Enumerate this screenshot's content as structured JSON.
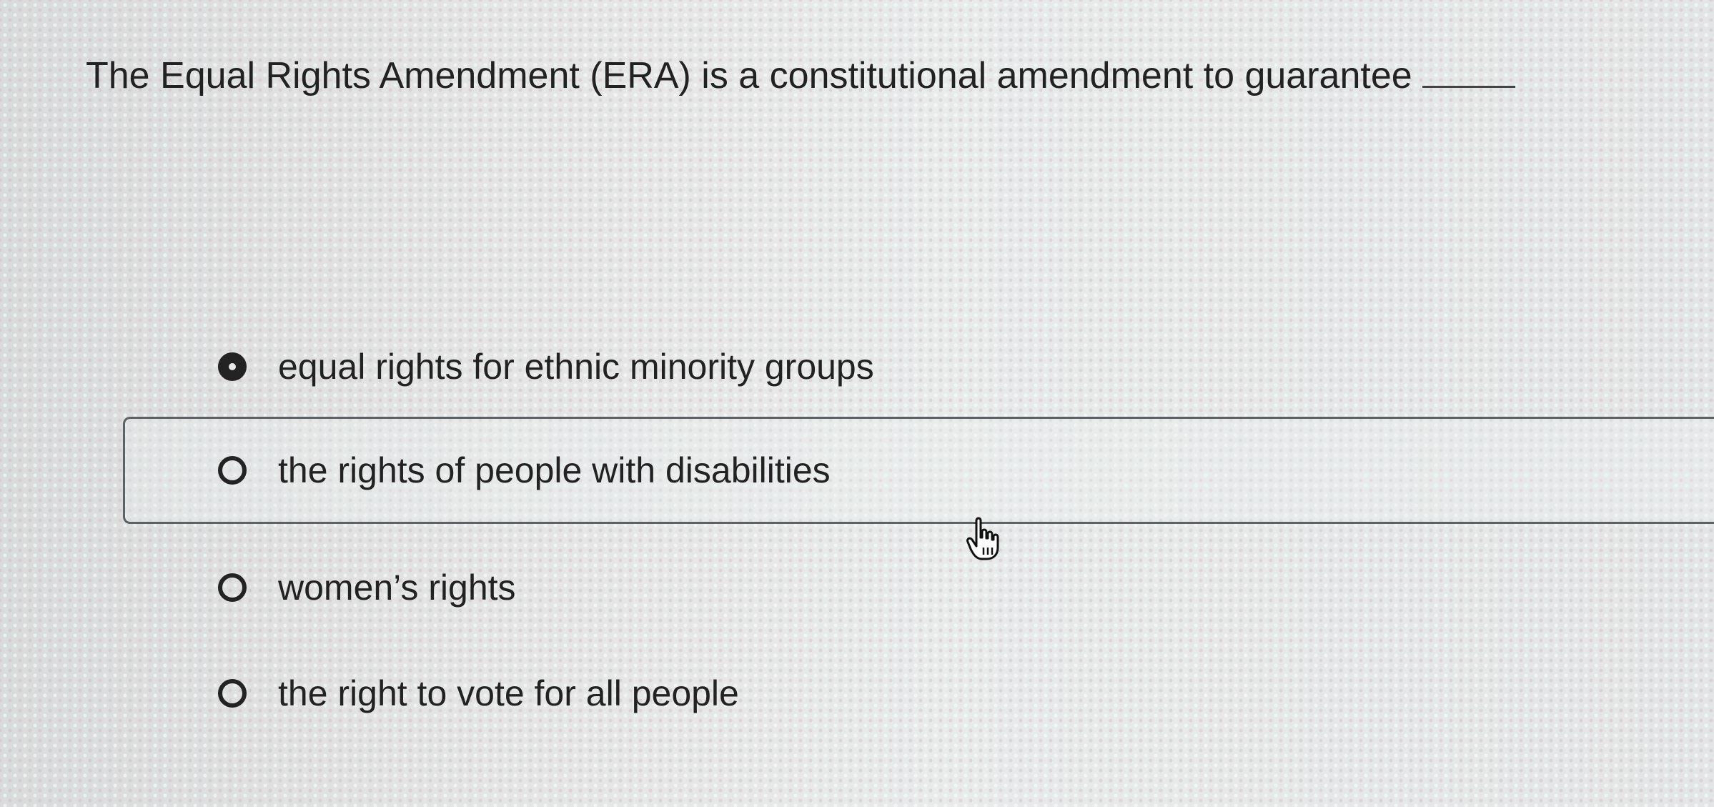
{
  "question": {
    "text": "The Equal Rights Amendment (ERA) is a constitutional amendment to guarantee"
  },
  "options": [
    {
      "label": "equal rights for ethnic minority groups",
      "selected": true
    },
    {
      "label": "the rights of people with disabilities",
      "selected": false,
      "hovered": true
    },
    {
      "label": "women’s rights",
      "selected": false
    },
    {
      "label": "the right to vote for all people",
      "selected": false
    }
  ],
  "cursor": {
    "icon": "hand-pointer-icon"
  }
}
